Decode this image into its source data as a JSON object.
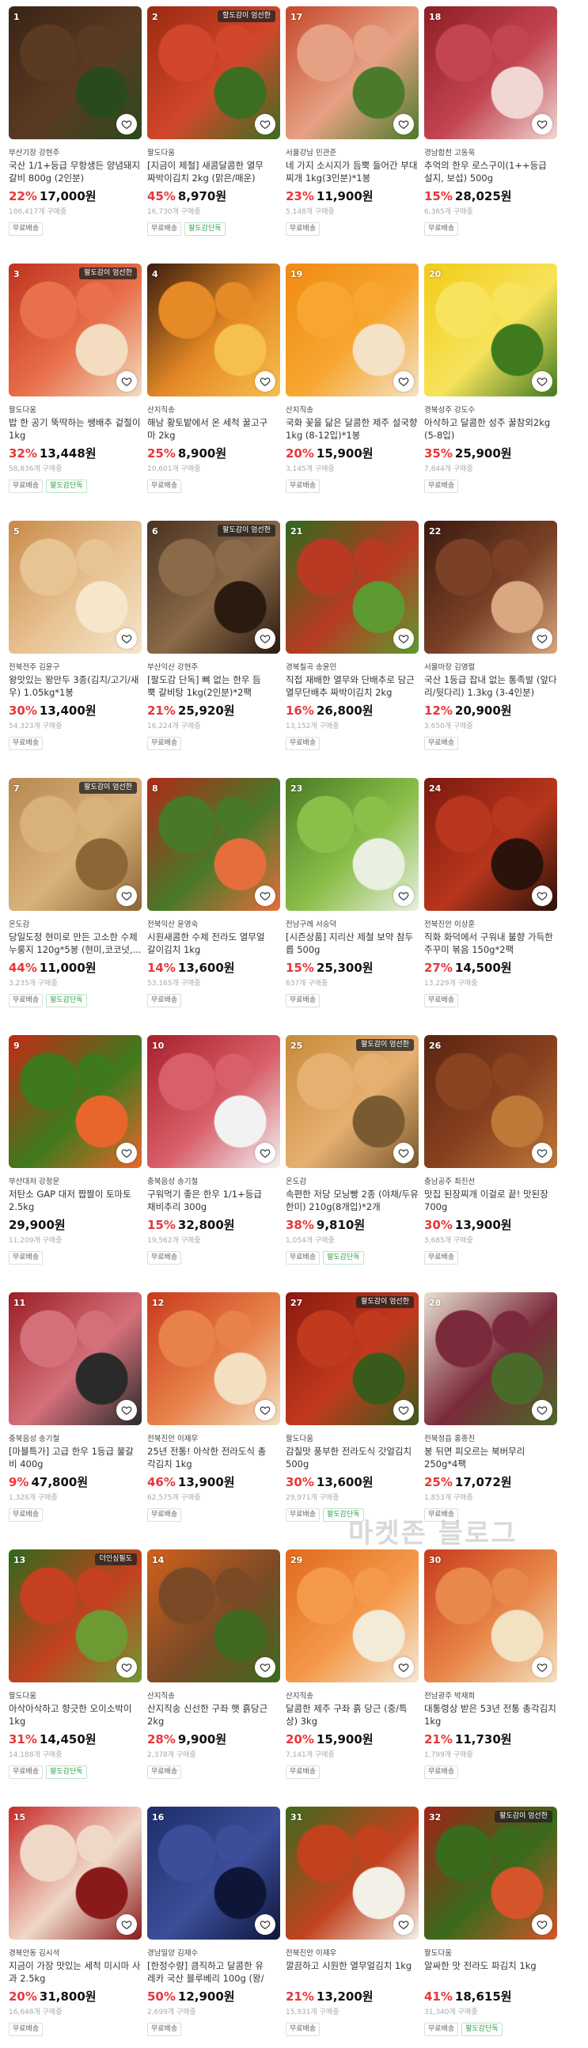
{
  "products": [
    {
      "rank": "1",
      "tag": "",
      "seller": "부산기장 강현주",
      "title": "국산 1/1+등급 무항생든 양념돼지갈비 800g (2인분)",
      "pct": "22%",
      "price": "17,000원",
      "sold": "186,417개 구매중",
      "badges": [
        "무료배송"
      ],
      "colors": [
        "#3a2416",
        "#5b3a22",
        "#2a4a1c"
      ]
    },
    {
      "rank": "2",
      "tag": "할도감이 엄선한",
      "seller": "팔도다움",
      "title": "[지금이 제철] 새콤달콤한 열무짜박이김치 2kg (맑은/매운) 1kg",
      "pct": "45%",
      "price": "8,970원",
      "sold": "16,730개 구매중",
      "badges": [
        "무료배송",
        "팔도감단독"
      ],
      "colors": [
        "#9a2a12",
        "#d2472b",
        "#3b6e22"
      ]
    },
    {
      "rank": "17",
      "tag": "",
      "seller": "서울강남 민관준",
      "title": "네 가지 소시지가 듬뿍 들어간 부대찌개 1kg(3인분)*1봉",
      "pct": "23%",
      "price": "11,900원",
      "sold": "5,148개 구매중",
      "badges": [
        "무료배송"
      ],
      "colors": [
        "#c6472a",
        "#e6a184",
        "#4b7a2a"
      ]
    },
    {
      "rank": "18",
      "tag": "",
      "seller": "경남합천 고동욱",
      "title": "추억의 한우 로스구이(1++등급 설지, 보섭) 500g",
      "pct": "15%",
      "price": "28,025원",
      "sold": "6,365개 구매중",
      "badges": [
        "무료배송"
      ],
      "colors": [
        "#8f1d24",
        "#c24551",
        "#f1d7d4"
      ]
    },
    {
      "rank": "3",
      "tag": "팔도감이 엄선한",
      "seller": "팔도다움",
      "title": "밥 한 공기 뚝딱하는 쌩배추 겉절이 1kg",
      "pct": "32%",
      "price": "13,448원",
      "sold": "58,836개 구매중",
      "badges": [
        "무료배송",
        "팔도감단독"
      ],
      "colors": [
        "#c0331f",
        "#e8704a",
        "#f3dcc0"
      ]
    },
    {
      "rank": "4",
      "tag": "",
      "seller": "산지직송",
      "title": "해남 황토밭에서 온 세척 꿀고구마 2kg",
      "pct": "25%",
      "price": "8,900원",
      "sold": "10,601개 구매중",
      "badges": [
        "무료배송"
      ],
      "colors": [
        "#3a1c0e",
        "#e58a26",
        "#f6c04f"
      ]
    },
    {
      "rank": "19",
      "tag": "",
      "seller": "산지직송",
      "title": "국화 꽃을 닮은 달콤한 제주 설국향 1kg (8-12입)*1봉",
      "pct": "20%",
      "price": "15,900원",
      "sold": "3,145개 구매중",
      "badges": [
        "무료배송"
      ],
      "colors": [
        "#f08a12",
        "#f7a731",
        "#f4e2c6"
      ]
    },
    {
      "rank": "20",
      "tag": "",
      "seller": "경북성주 강도수",
      "title": "아삭하고 달콤한 성주 꿀참외2kg (5-8입)",
      "pct": "35%",
      "price": "25,900원",
      "sold": "7,844개 구매중",
      "badges": [
        "무료배송"
      ],
      "colors": [
        "#f2cb17",
        "#f7e35c",
        "#3f7a1f"
      ]
    },
    {
      "rank": "5",
      "tag": "",
      "seller": "전북전주 김윤구",
      "title": "왕맛있는 왕만두 3종(김치/고기/새우) 1.05kg*1봉",
      "pct": "30%",
      "price": "13,400원",
      "sold": "54,323개 구매중",
      "badges": [
        "무료배송"
      ],
      "colors": [
        "#c98a4a",
        "#e8c393",
        "#f6e6cc"
      ]
    },
    {
      "rank": "6",
      "tag": "팔도감이 엄선한",
      "seller": "부산익산 강현주",
      "title": "[팔도감 단독] 뼈 없는 한우 듬뿍 갈비탕 1kg(2인분)*2팩",
      "pct": "21%",
      "price": "25,920원",
      "sold": "16,224개 구매중",
      "badges": [
        "무료배송"
      ],
      "colors": [
        "#4a3322",
        "#8a6a48",
        "#2b1a10"
      ]
    },
    {
      "rank": "21",
      "tag": "",
      "seller": "경북칠곡 송윤민",
      "title": "직접 재배한 열무와 단배추로 담근 열무단배추 짜박이김치 2kg",
      "pct": "16%",
      "price": "26,800원",
      "sold": "13,152개 구매중",
      "badges": [
        "무료배송"
      ],
      "colors": [
        "#2f6a1e",
        "#b83a22",
        "#5d9a30"
      ]
    },
    {
      "rank": "22",
      "tag": "",
      "seller": "서울마장 김영렬",
      "title": "국산 1등급 잡내 없는 통족발 (앞다리/뒷다리) 1.3kg (3-4인분)",
      "pct": "12%",
      "price": "20,900원",
      "sold": "3,650개 구매중",
      "badges": [
        "무료배송"
      ],
      "colors": [
        "#3a1a10",
        "#7a4126",
        "#d8a880"
      ]
    },
    {
      "rank": "7",
      "tag": "팔도감이 엄선한",
      "seller": "온도감",
      "title": "당일도정 현미로 만든 고소한 수제누룽지 120g*5봉 (현미,코코넛,...",
      "pct": "44%",
      "price": "11,000원",
      "sold": "3,235개 구매중",
      "badges": [
        "무료배송",
        "팔도감단독"
      ],
      "colors": [
        "#b58a52",
        "#d9b27a",
        "#8d6536"
      ]
    },
    {
      "rank": "8",
      "tag": "",
      "seller": "전북익산 윤영숙",
      "title": "시원새콤한 수제 전라도 열무얼갈이김치 1kg",
      "pct": "14%",
      "price": "13,600원",
      "sold": "53,165개 구매중",
      "badges": [
        "무료배송"
      ],
      "colors": [
        "#b02a1a",
        "#48792a",
        "#e66e3c"
      ]
    },
    {
      "rank": "23",
      "tag": "",
      "seller": "전남구례 서승덕",
      "title": "[시즌상품] 지리산 제철 보약 참두릅 500g",
      "pct": "15%",
      "price": "25,300원",
      "sold": "637개 구매중",
      "badges": [
        "무료배송"
      ],
      "colors": [
        "#4c7a26",
        "#8cbf4a",
        "#e9efe1"
      ]
    },
    {
      "rank": "24",
      "tag": "",
      "seller": "전북진안 이상훈",
      "title": "직화 화덕에서 구워내 불향 가득한 주꾸미 볶음 150g*2팩",
      "pct": "27%",
      "price": "14,500원",
      "sold": "13,229개 구매중",
      "badges": [
        "무료배송"
      ],
      "colors": [
        "#7a1a10",
        "#b8361c",
        "#2b120a"
      ]
    },
    {
      "rank": "9",
      "tag": "",
      "seller": "부산대저 강정운",
      "title": "저탄소 GAP 대저 짭짤이 토마토 2.5kg",
      "pct": "",
      "price": "29,900원",
      "sold": "11,209개 구매중",
      "badges": [
        "무료배송"
      ],
      "colors": [
        "#c42a14",
        "#3e7a1c",
        "#e8662c"
      ]
    },
    {
      "rank": "10",
      "tag": "",
      "seller": "충북음성 송기철",
      "title": "구워먹기 좋은 한우 1/1+등급 채비추리 300g",
      "pct": "15%",
      "price": "32,800원",
      "sold": "19,562개 구매중",
      "badges": [
        "무료배송"
      ],
      "colors": [
        "#a8202a",
        "#d8606a",
        "#f2f2f2"
      ]
    },
    {
      "rank": "25",
      "tag": "팔도감이 엄선한",
      "seller": "온도감",
      "title": "속편한 저당 모닝빵 2종 (야채/두유한미) 210g(8개입)*2개",
      "pct": "38%",
      "price": "9,810원",
      "sold": "1,054개 구매중",
      "badges": [
        "무료배송",
        "팔도감단독"
      ],
      "colors": [
        "#c88a3a",
        "#e6b070",
        "#7a5a30"
      ]
    },
    {
      "rank": "26",
      "tag": "",
      "seller": "충남공주 최진선",
      "title": "맛집 된장찌개 이걸로 끝! 맛된장 700g",
      "pct": "30%",
      "price": "13,900원",
      "sold": "3,685개 구매중",
      "badges": [
        "무료배송"
      ],
      "colors": [
        "#5a2410",
        "#8a4220",
        "#c07838"
      ]
    },
    {
      "rank": "11",
      "tag": "",
      "seller": "충북음성 송기철",
      "title": "[마블특가] 고급 한우 1등급 불갈비 400g",
      "pct": "9%",
      "price": "47,800원",
      "sold": "1,328개 구매중",
      "badges": [
        "무료배송"
      ],
      "colors": [
        "#9c1e26",
        "#d4707a",
        "#2a2a2a"
      ]
    },
    {
      "rank": "12",
      "tag": "",
      "seller": "전북진안 이재우",
      "title": "25년 전통! 아삭한 전라도식 총각김치 1kg",
      "pct": "46%",
      "price": "13,900원",
      "sold": "62,575개 구매중",
      "badges": [
        "무료배송"
      ],
      "colors": [
        "#c83a1c",
        "#e8824a",
        "#f3e0c0"
      ]
    },
    {
      "rank": "27",
      "tag": "팔도감이 엄선한",
      "seller": "팔도다움",
      "title": "감칠맛 풍부한 전라도식 갓얼김치 500g",
      "pct": "30%",
      "price": "13,600원",
      "sold": "29,971개 구매중",
      "badges": [
        "무료배송",
        "팔도감단독"
      ],
      "colors": [
        "#8a1a10",
        "#c23a1e",
        "#3a5a1c"
      ]
    },
    {
      "rank": "28",
      "tag": "",
      "seller": "전북정읍 홍종진",
      "title": "봉 뒤면 피오르는 북버무리 250g*4팩",
      "pct": "25%",
      "price": "17,072원",
      "sold": "1,853개 구매중",
      "badges": [
        "무료배송"
      ],
      "colors": [
        "#e8e0d0",
        "#7a2a3a",
        "#4a6a2a"
      ]
    },
    {
      "rank": "13",
      "tag": "더인싱필도",
      "seller": "팔도다움",
      "title": "아삭아삭하고 향긋한 오이소박이 1kg",
      "pct": "31%",
      "price": "14,450원",
      "sold": "14,188개 구매중",
      "badges": [
        "무료배송",
        "팔도감단독"
      ],
      "colors": [
        "#2e6a1c",
        "#c4401e",
        "#6e9a34"
      ]
    },
    {
      "rank": "14",
      "tag": "",
      "seller": "산지직송",
      "title": "산지직송 신선한 구좌 햇 흙당근 2kg",
      "pct": "28%",
      "price": "9,900원",
      "sold": "2,378개 구매중",
      "badges": [
        "무료배송"
      ],
      "colors": [
        "#d2601c",
        "#7a4a26",
        "#3f6a20"
      ]
    },
    {
      "rank": "29",
      "tag": "",
      "seller": "산지직송",
      "title": "달콤한 제주 구좌 흙 당근 (중/특상) 3kg",
      "pct": "20%",
      "price": "15,900원",
      "sold": "7,141개 구매중",
      "badges": [
        "무료배송"
      ],
      "colors": [
        "#e06a1c",
        "#f49a4a",
        "#f3ead8"
      ]
    },
    {
      "rank": "30",
      "tag": "",
      "seller": "전남광주 박재희",
      "title": "대통령상 받은 53년 전통 총각김치 1kg",
      "pct": "21%",
      "price": "11,730원",
      "sold": "1,799개 구매중",
      "badges": [
        "무료배송"
      ],
      "colors": [
        "#c83a1a",
        "#e8884a",
        "#f3e2c2"
      ]
    },
    {
      "rank": "15",
      "tag": "",
      "seller": "경북안동 김시석",
      "title": "지금이 가장 맛있는 세척 미시마 사과 2.5kg",
      "pct": "20%",
      "price": "31,800원",
      "sold": "16,648개 구매중",
      "badges": [
        "무료배송"
      ],
      "colors": [
        "#c82a2a",
        "#f0d8c8",
        "#8a1a1a"
      ]
    },
    {
      "rank": "16",
      "tag": "",
      "seller": "경남밀양 김재수",
      "title": "[한정수량] 큼직하고 달콤한 유레카 국산 블루베리 100g (왕/특...",
      "pct": "50%",
      "price": "12,900원",
      "sold": "2,699개 구매중",
      "badges": [
        "무료배송"
      ],
      "colors": [
        "#1e2e6a",
        "#3c4e9a",
        "#0e1638"
      ]
    },
    {
      "rank": "31",
      "tag": "",
      "seller": "전북진안 이재우",
      "title": "깔끔하고 시원한 열무얼김치 1kg",
      "pct": "21%",
      "price": "13,200원",
      "sold": "15,931개 구매중",
      "badges": [
        "무료배송"
      ],
      "colors": [
        "#3e6a1e",
        "#c2421e",
        "#f3f0e8"
      ]
    },
    {
      "rank": "32",
      "tag": "팔도감이 엄선한",
      "seller": "팔도다움",
      "title": "알싸한 맛 전라도 파김치 1kg",
      "pct": "41%",
      "price": "18,615원",
      "sold": "31,340개 구매중",
      "badges": [
        "무료배송",
        "팔도감단독"
      ],
      "colors": [
        "#a0221a",
        "#3a6a1c",
        "#d6542a"
      ]
    }
  ],
  "watermark": "마켓존 블로그"
}
